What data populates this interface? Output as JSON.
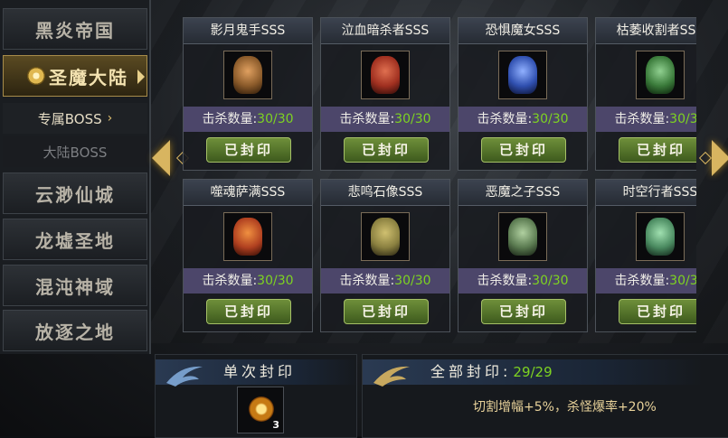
{
  "sidebar": {
    "items": [
      {
        "label": "黑炎帝国"
      },
      {
        "label": "圣魔大陆"
      },
      {
        "label": "专属BOSS"
      },
      {
        "label": "大陆BOSS"
      },
      {
        "label": "云渺仙城"
      },
      {
        "label": "龙墟圣地"
      },
      {
        "label": "混沌神域"
      },
      {
        "label": "放逐之地"
      }
    ],
    "active_item": "圣魔大陆",
    "active_sub": "专属BOSS",
    "sub_chevron": "›"
  },
  "bosses": [
    {
      "name": "影月鬼手SSS",
      "kill_label": "击杀数量:",
      "kills": "30/30",
      "button": "已封印",
      "color": "#8a5a2a"
    },
    {
      "name": "泣血暗杀者SSS",
      "kill_label": "击杀数量:",
      "kills": "30/30",
      "button": "已封印",
      "color": "#a03020"
    },
    {
      "name": "恐惧魔女SSS",
      "kill_label": "击杀数量:",
      "kills": "30/30",
      "button": "已封印",
      "color": "#3050b0"
    },
    {
      "name": "枯萎收割者SSS",
      "kill_label": "击杀数量:",
      "kills": "30/30",
      "button": "已封印",
      "color": "#3a7a3a"
    },
    {
      "name": "噬魂萨满SSS",
      "kill_label": "击杀数量:",
      "kills": "30/30",
      "button": "已封印",
      "color": "#b04020"
    },
    {
      "name": "悲鸣石像SSS",
      "kill_label": "击杀数量:",
      "kills": "30/30",
      "button": "已封印",
      "color": "#8a8040"
    },
    {
      "name": "恶魔之子SSS",
      "kill_label": "击杀数量:",
      "kills": "30/30",
      "button": "已封印",
      "color": "#5a7a50"
    },
    {
      "name": "时空行者SSS",
      "kill_label": "击杀数量:",
      "kills": "30/30",
      "button": "已封印",
      "color": "#4a8a60"
    }
  ],
  "single_seal": {
    "title": "单次封印",
    "item_quantity": "3"
  },
  "all_seal": {
    "title": "全部封印:",
    "count": "29/29",
    "bonus": "切割增幅+5%，杀怪爆率+20%"
  },
  "colors": {
    "accent_gold": "#d8b560",
    "kill_count_green": "#7ed321",
    "button_green": "#5a7a2a",
    "kill_bar": "#4c466a"
  }
}
